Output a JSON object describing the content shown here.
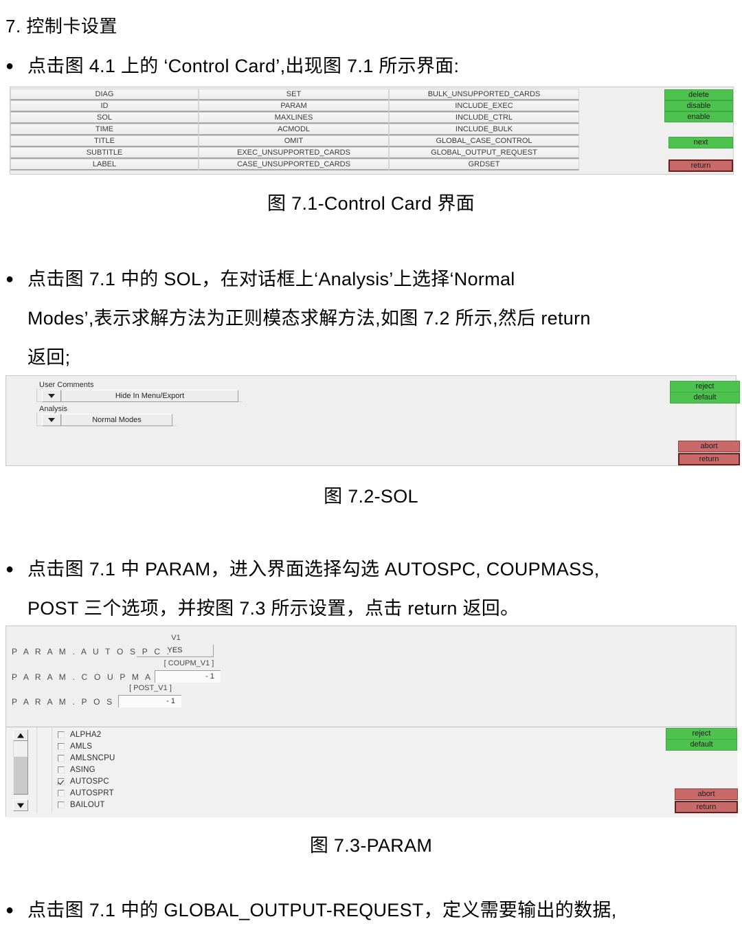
{
  "document": {
    "section_heading": "7. 控制卡设置",
    "paragraphs": [
      "点击图 4.1 上的 ‘Control Card’,出现图 7.1 所示界面:",
      "点击图 7.1 中的 SOL，在对话框上‘Analysis’上选择‘Normal Modes’,表示求解方法为正则模态求解方法,如图 7.2 所示,然后 return 返回;",
      "点击图 7.1 中 PARAM，进入界面选择勾选 AUTOSPC, COUPMASS, POST 三个选项，并按图 7.3 所示设置，点击 return 返回。",
      "点击图 7.1 中的 GLOBAL_OUTPUT-REQUEST，定义需要输出的数据,"
    ],
    "para2_line1": "点击图 7.1 中的 SOL，在对话框上‘Analysis’上选择‘Normal",
    "para2_line2": "Modes’,表示求解方法为正则模态求解方法,如图 7.2 所示,然后 return",
    "para2_line3": "返回;",
    "para3_line1": "点击图 7.1 中 PARAM，进入界面选择勾选 AUTOSPC, COUPMASS,",
    "para3_line2": "POST 三个选项，并按图 7.3 所示设置，点击 return 返回。",
    "para4_line1": "点击图 7.1 中的 GLOBAL_OUTPUT-REQUEST，定义需要输出的数据,",
    "bullet_glyph": "●",
    "captions": {
      "fig71": "图 7.1-Control Card 界面",
      "fig72": "图 7.2-SOL",
      "fig73": "图 7.3-PARAM"
    }
  },
  "figure71": {
    "columns": [
      [
        "DIAG",
        "ID",
        "SOL",
        "TIME",
        "TITLE",
        "SUBTITLE",
        "LABEL"
      ],
      [
        "SET",
        "PARAM",
        "MAXLINES",
        "ACMODL",
        "OMIT",
        "EXEC_UNSUPPORTED_CARDS",
        "CASE_UNSUPPORTED_CARDS"
      ],
      [
        "BULK_UNSUPPORTED_CARDS",
        "INCLUDE_EXEC",
        "INCLUDE_CTRL",
        "INCLUDE_BULK",
        "GLOBAL_CASE_CONTROL",
        "GLOBAL_OUTPUT_REQUEST",
        "GRDSET"
      ]
    ],
    "buttons": {
      "delete": "delete",
      "disable": "disable",
      "enable": "enable",
      "next": "next",
      "return": "return"
    },
    "colors": {
      "green": "#4ec24e",
      "red": "#c96a6a"
    }
  },
  "figure72": {
    "group_user_comments": "User Comments",
    "combo_user_comments": "Hide In Menu/Export",
    "group_analysis": "Analysis",
    "combo_analysis": "Normal Modes",
    "buttons": {
      "reject": "reject",
      "default": "default",
      "abort": "abort",
      "return": "return"
    }
  },
  "figure73": {
    "rows": [
      {
        "label": "P A R A M . A U T O S P C .",
        "caption": "V1",
        "value": "YES",
        "style": "underline"
      },
      {
        "label": "P A R A M . C O U P M A S S .",
        "caption": "[ COUPM_V1 ]",
        "value": "- 1",
        "style": "box"
      },
      {
        "label": "P A R A M . P O S T .",
        "caption": "[ POST_V1 ]",
        "value": "- 1",
        "style": "box"
      }
    ],
    "checklist": [
      {
        "label": "ALPHA2",
        "checked": false
      },
      {
        "label": "AMLS",
        "checked": false
      },
      {
        "label": "AMLSNCPU",
        "checked": false
      },
      {
        "label": "ASING",
        "checked": false
      },
      {
        "label": "AUTOSPC",
        "checked": true
      },
      {
        "label": "AUTOSPRT",
        "checked": false
      },
      {
        "label": "BAILOUT",
        "checked": false
      }
    ],
    "buttons": {
      "reject": "reject",
      "default": "default",
      "abort": "abort",
      "return": "return"
    }
  }
}
